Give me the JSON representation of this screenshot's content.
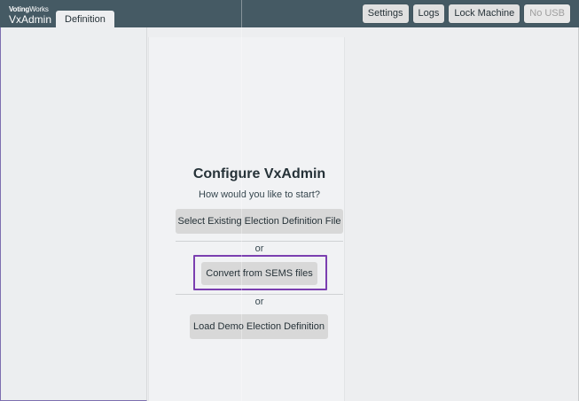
{
  "header": {
    "brand_company_bold": "Voting",
    "brand_company_light": "Works",
    "app_name": "VxAdmin",
    "tab_label": "Definition",
    "buttons": {
      "settings": "Settings",
      "logs": "Logs",
      "lock_machine": "Lock Machine",
      "no_usb": "No USB"
    }
  },
  "main": {
    "title": "Configure VxAdmin",
    "subtitle": "How would you like to start?",
    "select_existing_label": "Select Existing Election Definition File",
    "or_1": "or",
    "convert_sems_label": "Convert from SEMS files",
    "or_2": "or",
    "load_demo_label": "Load Demo Election Definition"
  },
  "colors": {
    "topbar": "#455a64",
    "background": "#edeef0",
    "highlight": "#7b3fb0"
  }
}
